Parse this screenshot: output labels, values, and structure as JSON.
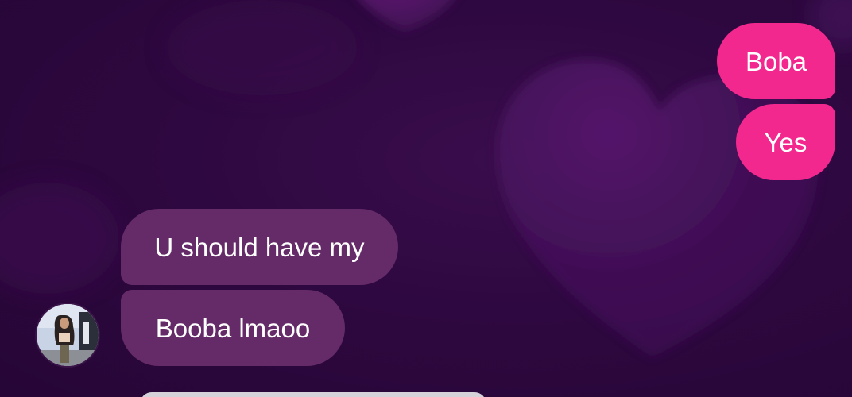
{
  "theme": {
    "outgoing_color": "#f2288e",
    "incoming_color": "#652a68",
    "background_color": "#2e0840"
  },
  "messages": {
    "outgoing": [
      {
        "text": "Boba"
      },
      {
        "text": "Yes"
      }
    ],
    "incoming": [
      {
        "text": "U should have my"
      },
      {
        "text": "Booba lmaoo"
      }
    ]
  },
  "contact": {
    "avatar_icon": "contact-avatar-photo"
  }
}
